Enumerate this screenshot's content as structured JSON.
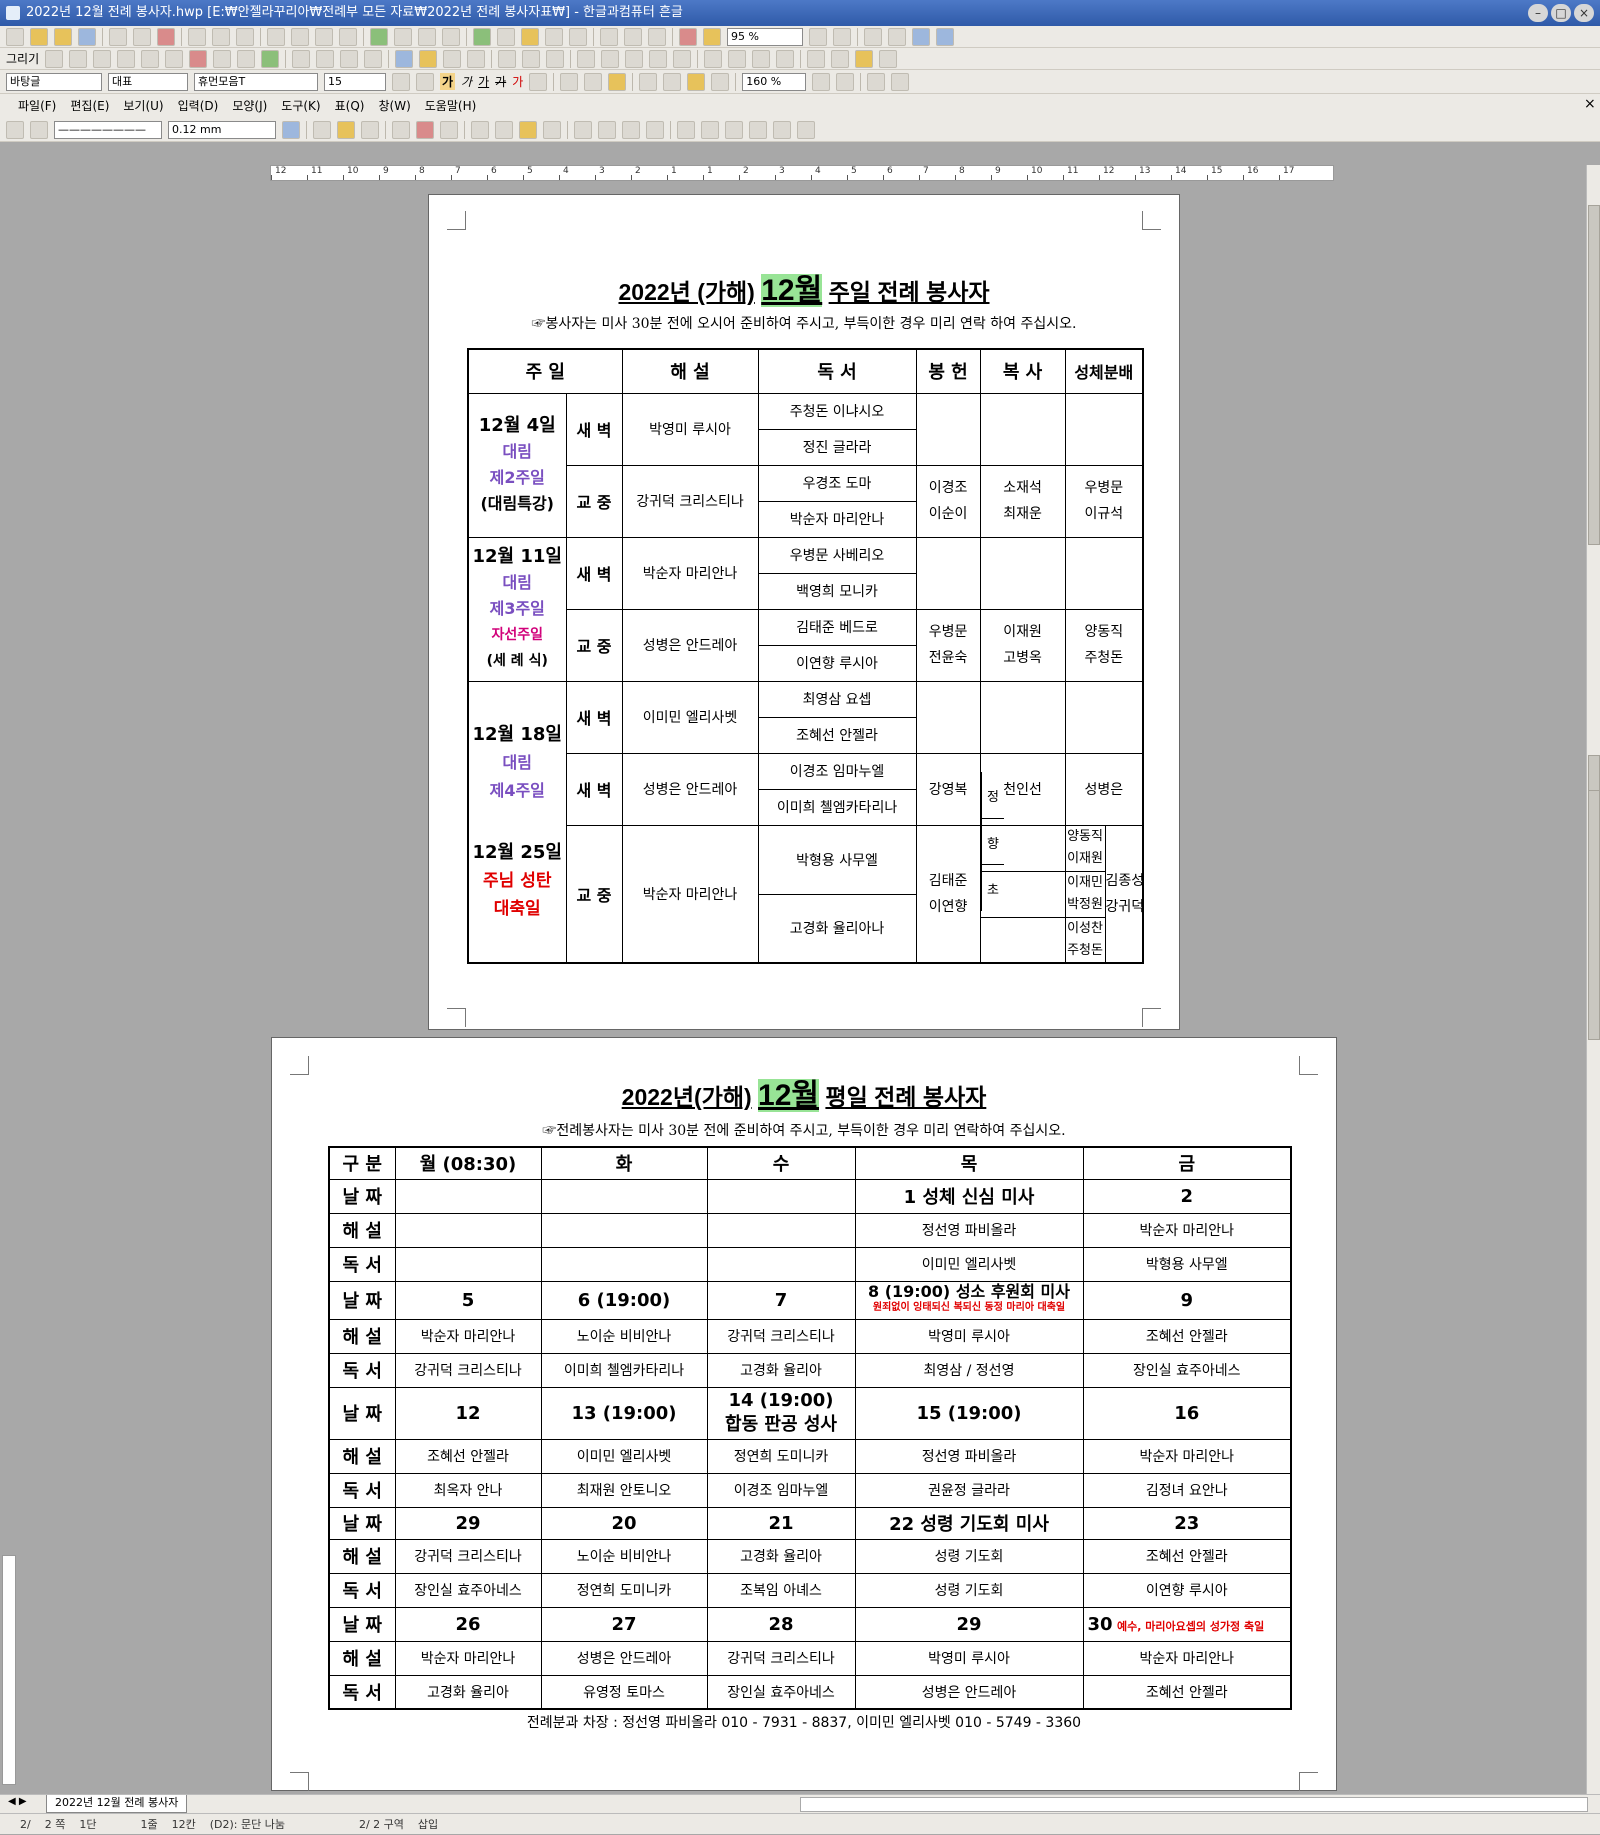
{
  "window": {
    "title": "2022년 12월 전례 봉사자.hwp [E:₩안젤라꾸리아₩전례부 모든 자료₩2022년 전례 봉사자표₩] - 한글과컴퓨터 흔글"
  },
  "toolbar": {
    "draw_label": "그리기",
    "zoom": "95 %",
    "style_select": "바탕글",
    "rep_select": "대표",
    "font_select": "휴먼모음T",
    "size_select": "15",
    "line_spacing": "160 %",
    "line_width": "0.12 mm",
    "bold_label": "가",
    "italic_label": "가",
    "underline_label": "가",
    "strike_label": "가",
    "color_label": "가"
  },
  "menu": [
    "파일(F)",
    "편집(E)",
    "보기(U)",
    "입력(D)",
    "모양(J)",
    "도구(K)",
    "표(Q)",
    "창(W)",
    "도움말(H)"
  ],
  "ruler": [
    "12",
    "11",
    "10",
    "9",
    "8",
    "7",
    "6",
    "5",
    "4",
    "3",
    "2",
    "1",
    "1",
    "2",
    "3",
    "4",
    "5",
    "6",
    "7",
    "8",
    "9",
    "10",
    "11",
    "12",
    "13",
    "14",
    "15",
    "16",
    "17"
  ],
  "page1": {
    "title_pre": "2022년 (가해)",
    "title_month": "12월",
    "title_post": "주일 전례 봉사자",
    "notice": "☞봉사자는 미사 30분 전에 오시어 준비하여 주시고, 부득이한 경우 미리 연락 하여 주십시오.",
    "headers": {
      "sunday": "주    일",
      "commentary": "해    설",
      "reader": "독    서",
      "offertory": "봉 헌",
      "server": "복 사",
      "communion": "성체분배"
    },
    "w1": {
      "date": "12월 4일",
      "l1": "대림",
      "l2": "제2주일",
      "l3": "(대림특강)",
      "dawn": "새 벽",
      "dawn_comm": "박영미 루시아",
      "dawn_r1": "주청돈 이냐시오",
      "dawn_r2": "정진 글라라",
      "mid": "교 중",
      "mid_comm": "강귀덕 크리스티나",
      "mid_r1": "우경조 도마",
      "mid_r2": "박순자 마리안나",
      "off1": "이경조",
      "off2": "이순이",
      "srv1": "소재석",
      "srv2": "최재운",
      "com1": "우병문",
      "com2": "이규석"
    },
    "w2": {
      "date": "12월 11일",
      "l1": "대림",
      "l2": "제3주일",
      "l3": "자선주일",
      "l4": "(세 례 식)",
      "dawn": "새 벽",
      "dawn_comm": "박순자 마리안나",
      "dawn_r1": "우병문 사베리오",
      "dawn_r2": "백영희 모니카",
      "mid": "교 중",
      "mid_comm": "성병은 안드레아",
      "mid_r1": "김태준 베드로",
      "mid_r2": "이연향 루시아",
      "off1": "우병문",
      "off2": "전윤숙",
      "srv1": "이재원",
      "srv2": "고병옥",
      "com1": "양동직",
      "com2": "주청돈"
    },
    "w3": {
      "date": "12월 18일",
      "l1": "대림",
      "l2": "제4주일",
      "dawn": "새 벽",
      "dawn_comm": "이미민 엘리사벳",
      "dawn_r1": "최영삼 요셉",
      "dawn_r2": "조혜선 안젤라",
      "mid_comm": "성병은 안드레아",
      "mid_r1": "이경조 임마누엘",
      "off": "강영복",
      "srv": "천인선",
      "com": "성병은"
    },
    "w4": {
      "date": "12월 25일",
      "l1": "주님 성탄",
      "l2": "대축일",
      "dawn": "새 벽",
      "dawn_r2": "이미희 첼엠카타리나",
      "mid": "교 중",
      "mid_comm": "박순자 마리안나",
      "mid_r1": "박형용 사무엘",
      "mid_r2": "고경화 율리아나",
      "off1": "김태준",
      "off2": "이연향",
      "jeong": "정",
      "jeong_n1": "양동직",
      "jeong_n2": "이재원",
      "hyang": "향",
      "hyang_n1": "이재민",
      "hyang_n2": "박정원",
      "cho": "초",
      "cho_n1": "이성찬",
      "cho_n2": "주청돈",
      "com1": "김종성",
      "com2": "강귀덕"
    }
  },
  "page2": {
    "title_pre": "2022년(가해)",
    "title_month": "12월",
    "title_post": "평일 전례 봉사자",
    "notice": "☞전례봉사자는 미사 30분 전에 준비하여 주시고, 부득이한 경우 미리 연락하여 주십시오.",
    "header": [
      "구  분",
      "월 (08:30)",
      "화",
      "수",
      "목",
      "금"
    ],
    "labels": {
      "date": "날  짜",
      "comm": "해  설",
      "reader": "독  서"
    },
    "weeks": [
      {
        "dates": [
          "",
          "",
          "",
          "1 성체 신심 미사",
          "2"
        ],
        "comm": [
          "",
          "",
          "",
          "정선영 파비올라",
          "박순자 마리안나"
        ],
        "reader": [
          "",
          "",
          "",
          "이미민 엘리사벳",
          "박형용 사무엘"
        ]
      },
      {
        "dates": [
          "5",
          "6 (19:00)",
          "7",
          "8 (19:00) 성소 후원회 미사",
          "9"
        ],
        "date_note": "원죄없이 잉태되신 복되신 동정 마리아 대축일",
        "comm": [
          "박순자 마리안나",
          "노이순 비비안나",
          "강귀덕 크리스티나",
          "박영미 루시아",
          "조혜선 안젤라"
        ],
        "reader": [
          "강귀덕 크리스티나",
          "이미희 첼엠카타리나",
          "고경화 율리아",
          "최영삼 / 정선영",
          "장인실 효주아네스"
        ]
      },
      {
        "dates": [
          "12",
          "13 (19:00)",
          "14 (19:00)",
          "15 (19:00)",
          "16"
        ],
        "date_sub": "합동 판공 성사",
        "comm": [
          "조혜선 안젤라",
          "이미민 엘리사벳",
          "정연희 도미니카",
          "정선영 파비올라",
          "박순자 마리안나"
        ],
        "reader": [
          "최옥자 안나",
          "최재원 안토니오",
          "이경조 임마누엘",
          "권윤정 글라라",
          "김정녀 요안나"
        ]
      },
      {
        "dates": [
          "29",
          "20",
          "21",
          "22 성령 기도회 미사",
          "23"
        ],
        "comm": [
          "강귀덕 크리스티나",
          "노이순 비비안나",
          "고경화 율리아",
          "성령 기도회",
          "조혜선 안젤라"
        ],
        "reader": [
          "장인실 효주아네스",
          "정연희 도미니카",
          "조복임 아녜스",
          "성령 기도회",
          "이연향 루시아"
        ]
      },
      {
        "dates": [
          "26",
          "27",
          "28",
          "29",
          "30"
        ],
        "date_note": "예수, 마리아요셉의 성가정 축일",
        "comm": [
          "박순자 마리안나",
          "성병은 안드레아",
          "강귀덕 크리스티나",
          "박영미 루시아",
          "박순자 마리안나"
        ],
        "reader": [
          "고경화 율리아",
          "유영정 토마스",
          "장인실 효주아네스",
          "성병은 안드레아",
          "조혜선 안젤라"
        ]
      }
    ],
    "contact": "전례분과 차장  :  정선영 파비올라 010 - 7931 - 8837,  이미민 엘리사벳  010 - 5749 - 3360"
  },
  "tabbar": {
    "doc_tab": "2022년 12월 전례 봉사자"
  },
  "status": [
    "2/",
    "2 쪽",
    "1단",
    "1줄",
    "12칸",
    "(D2): 문단 나눔",
    "2/  2 구역",
    "삽입"
  ],
  "colors": {
    "highlight": "#98e496",
    "purple": "#7a4fc0",
    "red": "#e00000",
    "magenta": "#d1007a",
    "titlebar": "#3b66b5"
  }
}
